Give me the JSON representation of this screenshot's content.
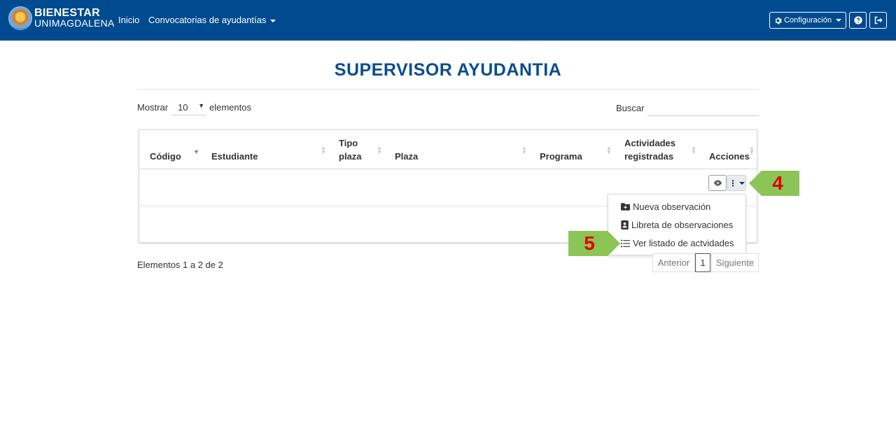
{
  "navbar": {
    "brand_line1": "BIENESTAR",
    "brand_line2": "UNIMAGDALENA",
    "links": {
      "inicio": "Inicio",
      "convocatorias": "Convocatorias de ayudantías"
    },
    "config_label": "Configuración",
    "help_icon": "question-circle-icon",
    "exit_icon": "sign-out-icon",
    "color": "#004a8f"
  },
  "page": {
    "title": "SUPERVISOR AYUDANTIA",
    "title_color": "#0a4d8c"
  },
  "controls": {
    "show_label": "Mostrar",
    "length_value": "10",
    "elements_label": "elementos",
    "search_label": "Buscar",
    "search_value": ""
  },
  "table": {
    "headers": {
      "codigo": "Código",
      "estudiante": "Estudiante",
      "tipo_1": "Tipo",
      "tipo_2": "plaza",
      "plaza": "Plaza",
      "programa": "Programa",
      "act_1": "Actividades",
      "act_2": "registradas",
      "acciones": "Acciones"
    },
    "sorted_column": "Código"
  },
  "dropdown": {
    "items": [
      {
        "label": "Nueva observación",
        "icon": "folder-plus-icon"
      },
      {
        "label": "Libreta de observaciones",
        "icon": "address-book-icon"
      },
      {
        "label": "Ver listado de actvidades",
        "icon": "list-icon"
      }
    ]
  },
  "footer": {
    "info": "Elementos 1 a 2 de 2",
    "prev": "Anterior",
    "page": "1",
    "next": "Siguiente"
  },
  "annotations": {
    "step4": "4",
    "step5": "5",
    "color": "#8dc456"
  }
}
